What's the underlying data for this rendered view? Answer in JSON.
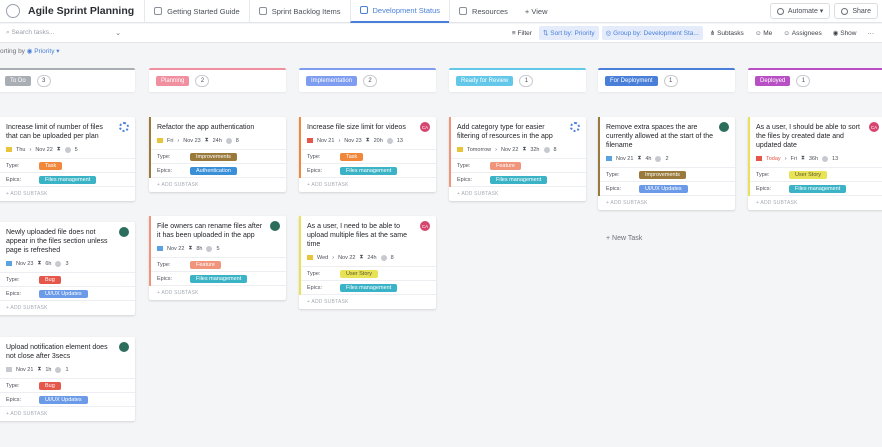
{
  "header": {
    "app_title": "Agile Sprint Planning",
    "tabs": [
      {
        "label": "Getting Started Guide",
        "active": false
      },
      {
        "label": "Sprint Backlog Items",
        "active": false
      },
      {
        "label": "Development Status",
        "active": true
      },
      {
        "label": "Resources",
        "active": false
      }
    ],
    "add_view": "+ View",
    "automate": "Automate",
    "share": "Share"
  },
  "toolbar": {
    "search_placeholder": "Search tasks...",
    "filter": "Filter",
    "sort": "Sort by: Priority",
    "group": "Group by: Development Sta...",
    "subtasks": "Subtasks",
    "me": "Me",
    "assignees": "Assignees",
    "show": "Show",
    "more": "···"
  },
  "sort_row": {
    "prefix": "orting by",
    "value": "Priority"
  },
  "colors": {
    "todo": "#a9adb4",
    "planning": "#f08f9f",
    "implementation": "#7e9df0",
    "review": "#62c7e8",
    "deployment": "#4a7fd9",
    "deployed": "#b84fc4",
    "task": "#f0873a",
    "feature": "#f0947c",
    "bug": "#e5574a",
    "user_story": "#e8e356",
    "improvements": "#9a7a3c",
    "authentication": "#3a8fd9",
    "files_management": "#3bb3c6",
    "ux_updates": "#6b9ae8"
  },
  "columns": [
    {
      "name": "To Do",
      "count": "3",
      "color": "#a9adb4"
    },
    {
      "name": "Planning",
      "count": "2",
      "color": "#f08f9f"
    },
    {
      "name": "Implementation",
      "count": "2",
      "color": "#7e9df0"
    },
    {
      "name": "Ready for Review",
      "count": "1",
      "color": "#62c7e8"
    },
    {
      "name": "For Deployment",
      "count": "1",
      "color": "#4a7fd9"
    },
    {
      "name": "Deployed",
      "count": "1",
      "color": "#b84fc4"
    }
  ],
  "field_labels": {
    "type": "Type:",
    "epics": "Epics:"
  },
  "add_subtask": "+ ADD SUBTASK",
  "new_task": "+ New Task",
  "cards": {
    "todo_1": {
      "title": "Increase limit of number of files that can be uploaded per plan",
      "date": "Thu",
      "due": "Nov 22",
      "est": "",
      "count": "5",
      "type": "Task",
      "epic": "Files management"
    },
    "todo_2": {
      "title": "Newly uploaded file does not appear in the files section unless page is refreshed",
      "date": "Nov 23",
      "est": "6h",
      "count": "3",
      "type": "Bug",
      "epic": "UI/UX Updates"
    },
    "todo_3": {
      "title": "Upload notification element does not close after 3secs",
      "date": "Nov 21",
      "est": "1h",
      "count": "1",
      "type": "Bug",
      "epic": "UI/UX Updates"
    },
    "plan_1": {
      "title": "Refactor the app authentication",
      "date": "Fri",
      "due": "Nov 23",
      "est": "24h",
      "count": "8",
      "type": "Improvements",
      "epic": "Authentication"
    },
    "plan_2": {
      "title": "File owners can rename files after it has been uploaded in the app",
      "date": "Nov 22",
      "est": "8h",
      "count": "5",
      "type": "Feature",
      "epic": "Files management"
    },
    "impl_1": {
      "title": "Increase file size limit for videos",
      "date": "Nov 21",
      "due": "Nov 23",
      "est": "20h",
      "count": "13",
      "type": "Task",
      "epic": "Files management",
      "avatar": "CA"
    },
    "impl_2": {
      "title": "As a user, I need to be able to upload multiple files at the same time",
      "date": "Wed",
      "due": "Nov 22",
      "est": "24h",
      "count": "8",
      "type": "User Story",
      "epic": "Files management",
      "avatar": "CA"
    },
    "rev_1": {
      "title": "Add category type for easier filtering of resources in the app",
      "date": "Tomorrow",
      "due": "Nov 22",
      "est": "32h",
      "count": "8",
      "type": "Feature",
      "epic": "Files management"
    },
    "dep_1": {
      "title": "Remove extra spaces the are currently allowed at the start of the filename",
      "date": "Nov 21",
      "est": "4h",
      "count": "2",
      "type": "Improvements",
      "epic": "UI/UX Updates"
    },
    "dpd_1": {
      "title": "As a user, I should be able to sort the files by created date and updated date",
      "date": "Today",
      "due": "Fri",
      "est": "36h",
      "count": "13",
      "type": "User Story",
      "epic": "Files management",
      "avatar": "CA"
    }
  }
}
